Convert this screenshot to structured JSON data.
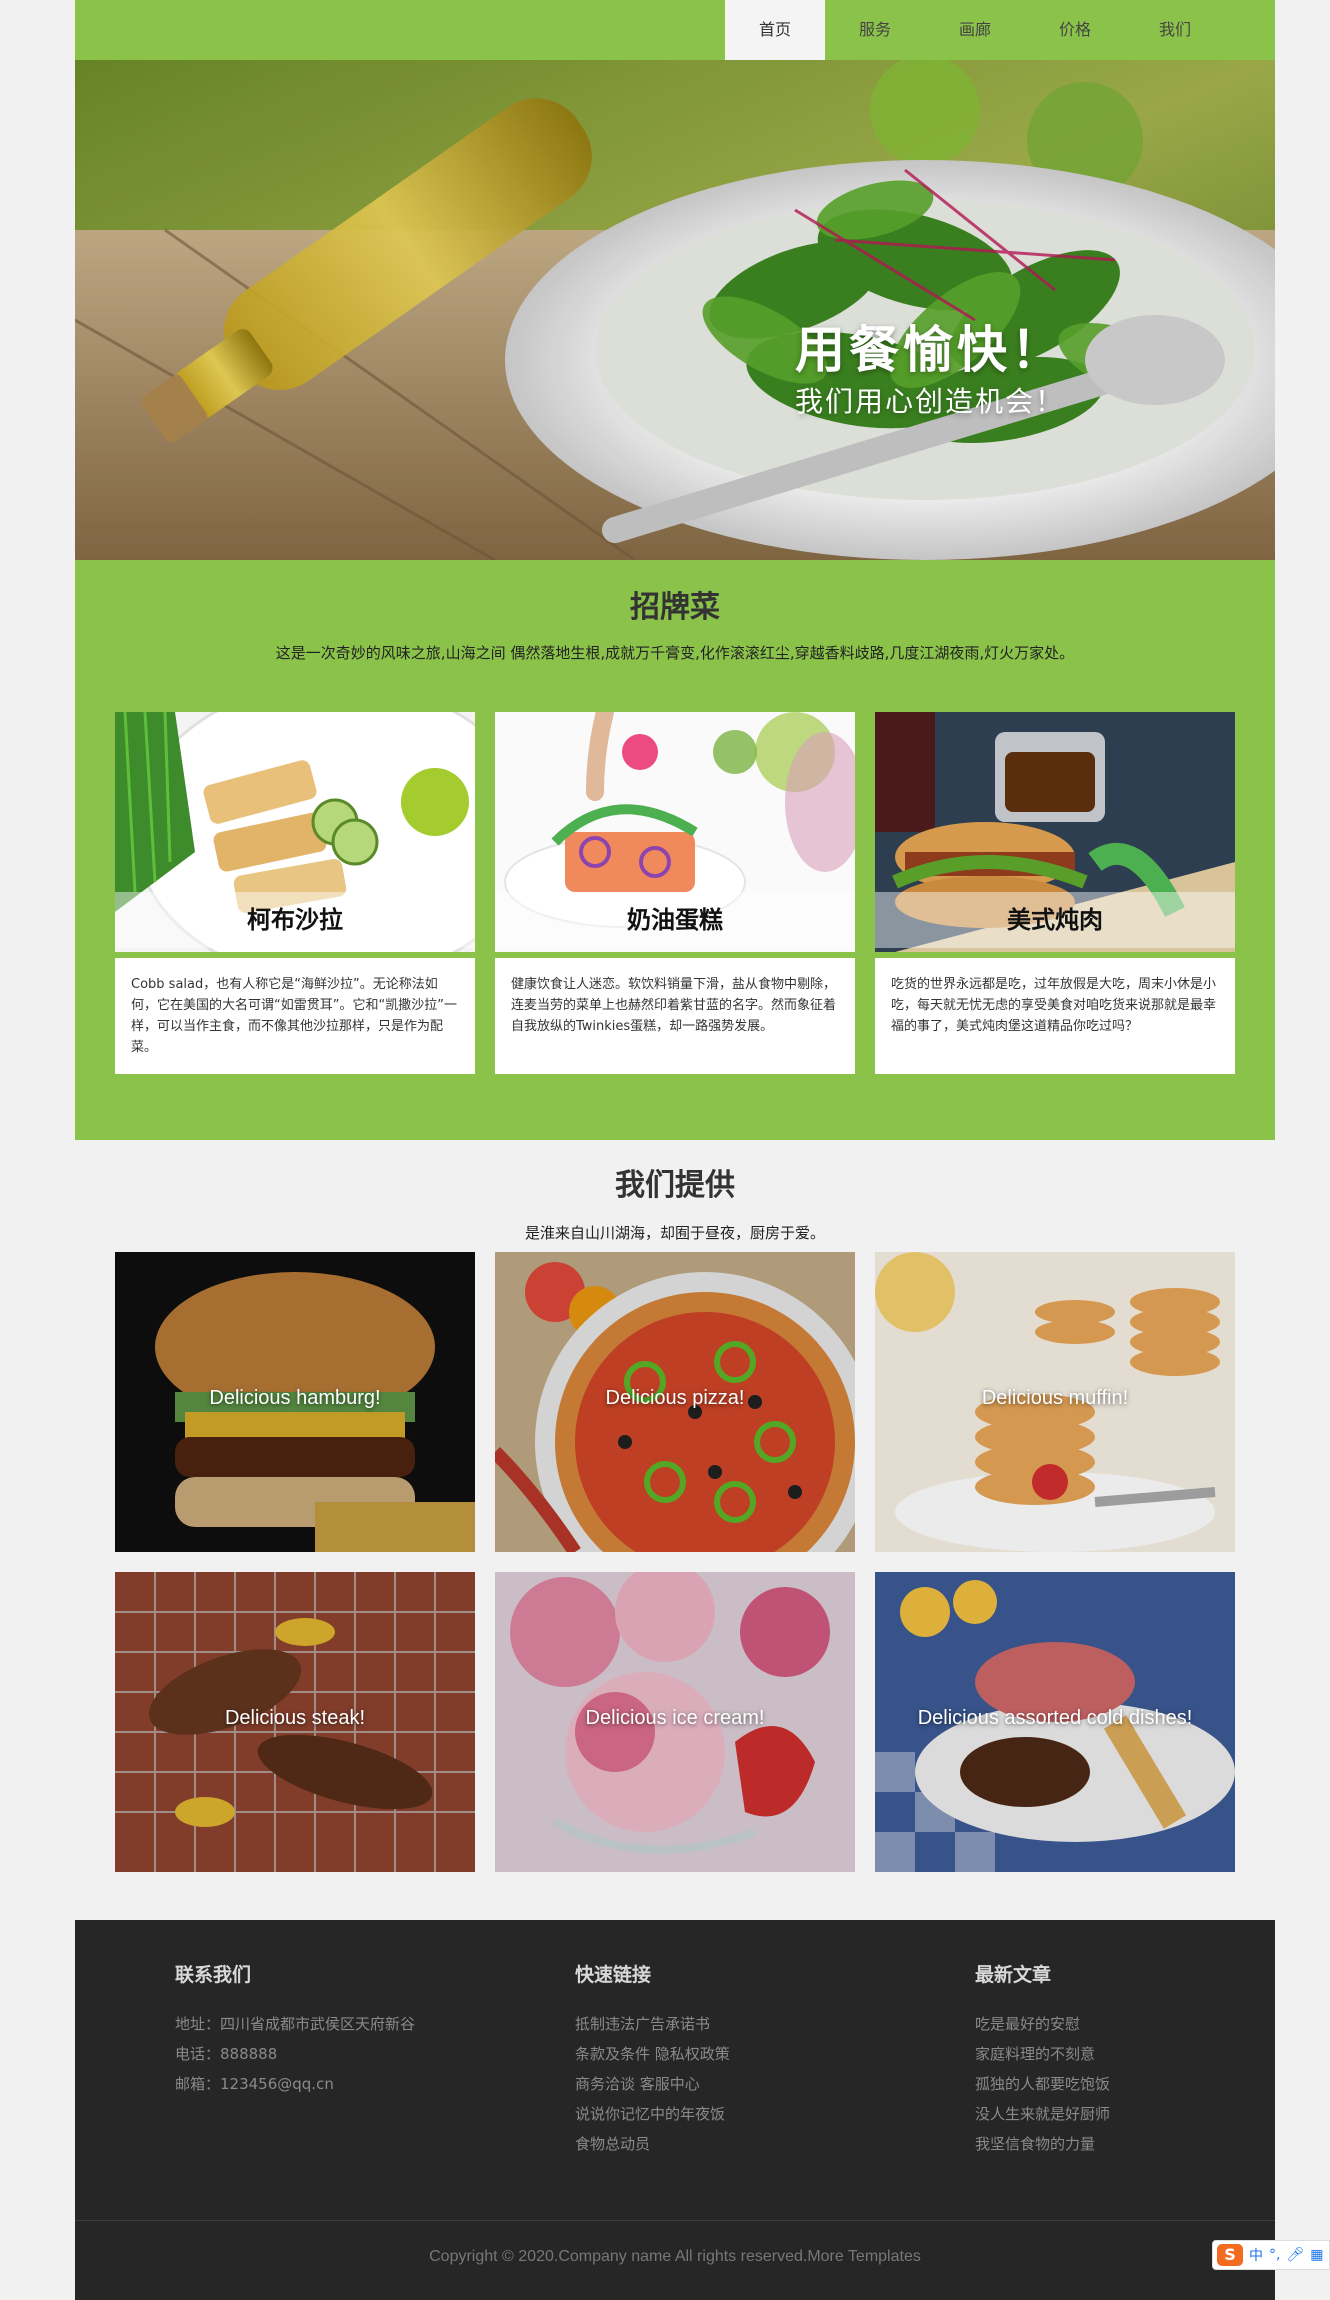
{
  "nav": {
    "items": [
      {
        "label": "首页",
        "active": true
      },
      {
        "label": "服务",
        "active": false
      },
      {
        "label": "画廊",
        "active": false
      },
      {
        "label": "价格",
        "active": false
      },
      {
        "label": "我们",
        "active": false
      }
    ]
  },
  "hero": {
    "title": "用餐愉快！",
    "subtitle": "我们用心创造机会！"
  },
  "signature": {
    "title": "招牌菜",
    "description": "这是一次奇妙的风味之旅,山海之间 偶然落地生根,成就万千膏变,化作滚滚红尘,穿越香料歧路,几度江湖夜雨,灯火万家处。",
    "cards": [
      {
        "name": "柯布沙拉",
        "text": "Cobb salad，也有人称它是“海鲜沙拉”。无论称法如何，它在美国的大名可谓“如雷贯耳”。它和“凯撒沙拉”一样，可以当作主食，而不像其他沙拉那样，只是作为配菜。"
      },
      {
        "name": "奶油蛋糕",
        "text": "健康饮食让人迷恋。软饮料销量下滑，盐从食物中剔除，连麦当劳的菜单上也赫然印着紫甘蓝的名字。然而象征着自我放纵的Twinkies蛋糕，却一路强势发展。"
      },
      {
        "name": "美式炖肉",
        "text": "吃货的世界永远都是吃，过年放假是大吃，周末小休是小吃，每天就无忧无虑的享受美食对咱吃货来说那就是最幸福的事了，美式炖肉堡这道精品你吃过吗？"
      }
    ]
  },
  "offer": {
    "title": "我们提供",
    "description": "是淮来自山川湖海，却囿于昼夜，厨房于爱。",
    "tiles": [
      "Delicious hamburg!",
      "Delicious pizza!",
      "Delicious muffin!",
      "Delicious steak!",
      "Delicious ice cream!",
      "Delicious assorted cold dishes!"
    ]
  },
  "footer": {
    "contact": {
      "title": "联系我们",
      "address": "地址：四川省成都市武侯区天府新谷",
      "phone": "电话：888888",
      "email": "邮箱：123456@qq.cn"
    },
    "links": {
      "title": "快速链接",
      "items": [
        "抵制违法广告承诺书",
        "条款及条件 隐私权政策",
        "商务洽谈 客服中心",
        "说说你记忆中的年夜饭",
        "食物总动员"
      ]
    },
    "articles": {
      "title": "最新文章",
      "items": [
        "吃是最好的安慰",
        "家庭料理的不刻意",
        "孤独的人都要吃饱饭",
        "没人生来就是好厨师",
        "我坚信食物的力量"
      ]
    },
    "copyright": "Copyright © 2020.Company name All rights reserved.More Templates"
  },
  "ime": {
    "logo": "S",
    "mode": "中"
  },
  "colors": {
    "accent": "#8bc34a",
    "footer": "#262626",
    "page_bg": "#f1f1f1"
  }
}
